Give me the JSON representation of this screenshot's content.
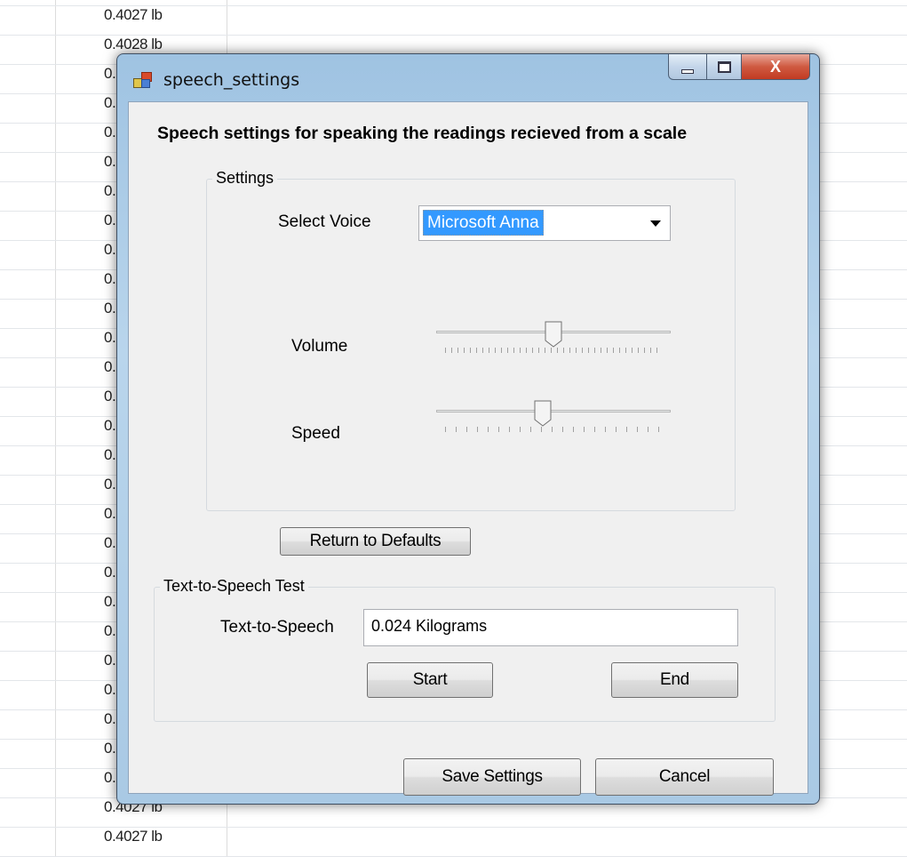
{
  "background": {
    "column_values": [
      "0.4027 lb",
      "0.4028 lb",
      "0.",
      "0.",
      "0.",
      "0.",
      "0.",
      "0.",
      "0.",
      "0.",
      "0.",
      "0.",
      "0.",
      "0.",
      "0.",
      "0.",
      "0.",
      "0.",
      "0.",
      "0.",
      "0.",
      "0.",
      "0.",
      "0.",
      "0.",
      "0.",
      "0.",
      "0.4027 lb",
      "0.4027 lb"
    ]
  },
  "window": {
    "title": "speech_settings",
    "icon": "winforms-app-icon",
    "controls": {
      "minimize": "minimize-icon",
      "maximize": "maximize-icon",
      "close_label": "X"
    }
  },
  "heading": "Speech settings for speaking the readings recieved from a scale",
  "settings": {
    "group_title": "Settings",
    "voice_label": "Select Voice",
    "voice_value": "Microsoft Anna",
    "volume_label": "Volume",
    "volume_level": 0.5,
    "speed_label": "Speed",
    "speed_level": 0.45,
    "defaults_button": "Return to Defaults"
  },
  "tts": {
    "group_title": "Text-to-Speech Test",
    "field_label": "Text-to-Speech",
    "field_value": "0.024 Kilograms",
    "start_button": "Start",
    "end_button": "End"
  },
  "footer": {
    "save_button": "Save Settings",
    "cancel_button": "Cancel"
  },
  "colors": {
    "selection": "#3399ff",
    "window_frame": "#b9d5ec",
    "close_button": "#c23b22"
  }
}
